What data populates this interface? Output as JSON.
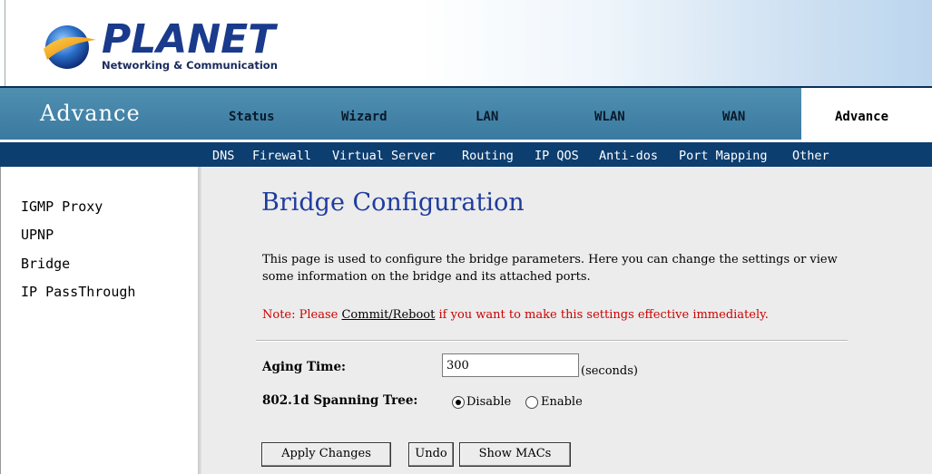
{
  "brand": {
    "name": "PLANET",
    "tagline": "Networking & Communication"
  },
  "nav": {
    "section_title": "Advance",
    "tabs": [
      {
        "label": "Status"
      },
      {
        "label": "Wizard"
      },
      {
        "label": "LAN"
      },
      {
        "label": "WLAN"
      },
      {
        "label": "WAN"
      },
      {
        "label": "Advance"
      }
    ],
    "active_tab": "Advance",
    "subnav": [
      {
        "label": "DNS"
      },
      {
        "label": "Firewall"
      },
      {
        "label": "Virtual Server"
      },
      {
        "label": "Routing"
      },
      {
        "label": "IP QOS"
      },
      {
        "label": "Anti-dos"
      },
      {
        "label": "Port Mapping"
      },
      {
        "label": "Other"
      }
    ]
  },
  "sidebar": {
    "items": [
      {
        "label": "IGMP Proxy"
      },
      {
        "label": "UPNP"
      },
      {
        "label": "Bridge"
      },
      {
        "label": "IP PassThrough"
      }
    ]
  },
  "main": {
    "title": "Bridge Configuration",
    "description": "This page is used to configure the bridge parameters. Here you can change the settings or view some information on the bridge and its attached ports.",
    "note_prefix": "Note: Please ",
    "note_link": "Commit/Reboot",
    "note_suffix": " if you want to make this settings effective immediately.",
    "aging_time": {
      "label": "Aging Time:",
      "value": "300",
      "unit": "(seconds)"
    },
    "spanning_tree": {
      "label": "802.1d Spanning Tree:",
      "options": [
        {
          "label": "Disable",
          "selected": true
        },
        {
          "label": "Enable",
          "selected": false
        }
      ]
    },
    "buttons": {
      "apply": "Apply Changes",
      "undo": "Undo",
      "show_macs": "Show MACs"
    }
  },
  "colors": {
    "nav_bar": "#3b7aa0",
    "subnav_bar": "#0d3e70",
    "title_blue": "#1f3c9e",
    "note_red": "#cc0000",
    "main_bg": "#ececec"
  }
}
